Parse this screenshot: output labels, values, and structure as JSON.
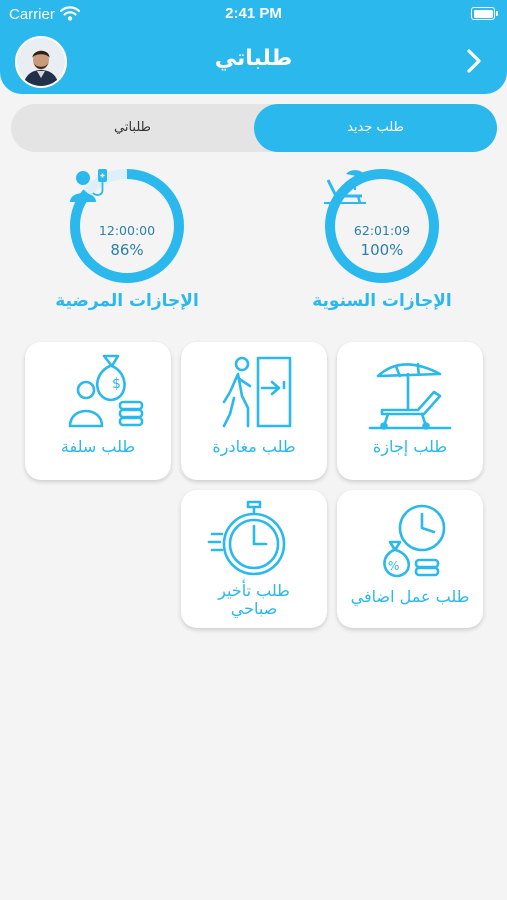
{
  "status_bar": {
    "carrier": "Carrier",
    "time": "2:41 PM"
  },
  "header": {
    "title": "طلباتي",
    "back_icon": "chevron-right-icon",
    "avatar": "user-avatar"
  },
  "tabs": {
    "left_label": "طلباتي",
    "right_label": "طلب جديد",
    "active": "طلب جديد"
  },
  "balances": [
    {
      "title": "الإجازات السنوية",
      "time": "62:01:09",
      "percent": "100%",
      "fraction": 1.0,
      "icon": "beach-chair-icon"
    },
    {
      "title": "الإجازات المرضية",
      "time": "12:00:00",
      "percent": "86%",
      "fraction": 0.86,
      "icon": "patient-iv-icon"
    }
  ],
  "requests": [
    {
      "label": "طلب إجازة",
      "icon": "beach-lounger-umbrella-icon"
    },
    {
      "label": "طلب مغادرة",
      "icon": "person-exit-door-icon"
    },
    {
      "label": "طلب سلفة",
      "icon": "money-bag-worker-icon"
    },
    {
      "label": "طلب عمل اضافي",
      "icon": "clock-money-bag-icon"
    },
    {
      "label_line1": "طلب تأخير",
      "label_line2": "صباحي",
      "icon": "stopwatch-icon"
    }
  ],
  "colors": {
    "primary": "#2bb8ec",
    "track": "#ddeff8",
    "background": "#f4f4f4",
    "value_text": "#2c7fa8"
  }
}
